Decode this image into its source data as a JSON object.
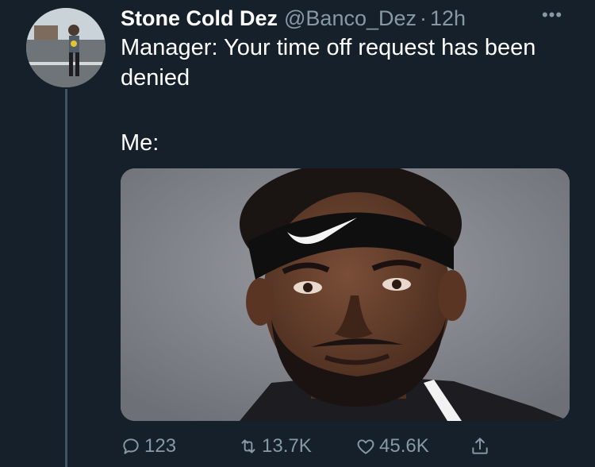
{
  "tweet": {
    "display_name": "Stone Cold Dez",
    "handle": "@Banco_Dez",
    "separator": "·",
    "time": "12h",
    "more_label": "•••",
    "text_line1": "Manager: Your time off request has been denied",
    "text_line2": "Me:"
  },
  "actions": {
    "replies": "123",
    "retweets": "13.7K",
    "likes": "45.6K"
  },
  "icons": {
    "reply": "reply-icon",
    "retweet": "retweet-icon",
    "like": "heart-icon",
    "share": "share-icon",
    "more": "more-icon"
  },
  "colors": {
    "background": "#15202b",
    "muted": "#8899a6",
    "text": "#ffffff"
  }
}
